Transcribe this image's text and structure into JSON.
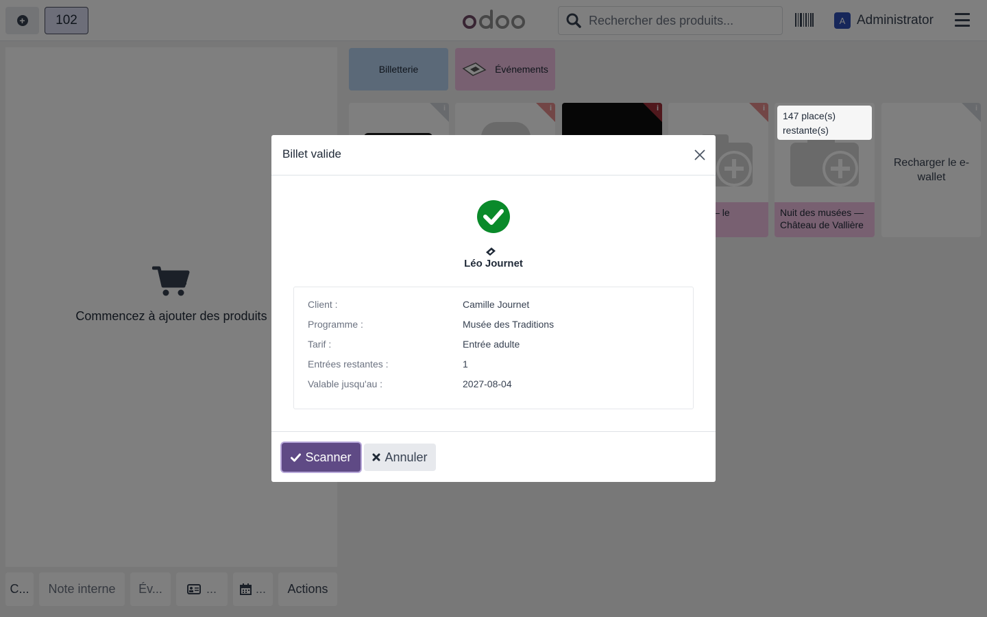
{
  "topbar": {
    "order_number": "102",
    "search_placeholder": "Rechercher des produits...",
    "user_initial": "A",
    "user_name": "Administrator"
  },
  "order": {
    "empty_text": "Commencez à ajouter des produits"
  },
  "bottom_actions": [
    {
      "label": "C..."
    },
    {
      "label": "Note interne"
    },
    {
      "label": "Év..."
    },
    {
      "label": "..."
    },
    {
      "label": "..."
    },
    {
      "label": "Actions"
    }
  ],
  "categories": [
    {
      "label": "Billetterie",
      "color": "#b7d3f1"
    },
    {
      "label": "Événements",
      "color": "#f1c1e2"
    }
  ],
  "products": [
    {
      "name": "musées — le Vallière"
    },
    {
      "places": "147 place(s) restante(s)",
      "name": "Nuit des musées — Château de Vallière"
    },
    {
      "name": "Recharger le e-wallet"
    }
  ],
  "modal": {
    "title": "Billet valide",
    "holder_name": "Léo Journet",
    "details": [
      {
        "label": "Client :",
        "value": "Camille Journet"
      },
      {
        "label": "Programme :",
        "value": "Musée des Traditions"
      },
      {
        "label": "Tarif :",
        "value": "Entrée adulte"
      },
      {
        "label": "Entrées restantes :",
        "value": "1"
      },
      {
        "label": "Valable jusqu'au :",
        "value": "2027-08-04"
      }
    ],
    "scan_label": "Scanner",
    "cancel_label": "Annuler"
  },
  "colors": {
    "primary": "#5f4a85",
    "success": "#0a8a2a",
    "billetterie": "#b7d3f1",
    "evenements": "#f1c1e2"
  }
}
